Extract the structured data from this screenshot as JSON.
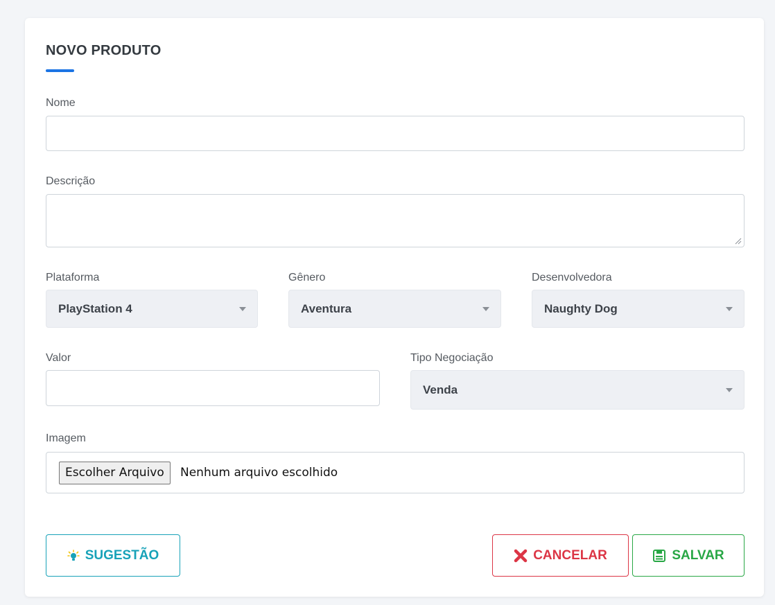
{
  "form": {
    "title": "NOVO PRODUTO",
    "fields": {
      "nome": {
        "label": "Nome",
        "value": ""
      },
      "descricao": {
        "label": "Descrição",
        "value": ""
      },
      "plataforma": {
        "label": "Plataforma",
        "value": "PlayStation 4"
      },
      "genero": {
        "label": "Gênero",
        "value": "Aventura"
      },
      "desenvolvedora": {
        "label": "Desenvolvedora",
        "value": "Naughty Dog"
      },
      "valor": {
        "label": "Valor",
        "value": ""
      },
      "tipo_negociacao": {
        "label": "Tipo Negociação",
        "value": "Venda"
      },
      "imagem": {
        "label": "Imagem",
        "button_label": "Escolher Arquivo",
        "status": "Nenhum arquivo escolhido"
      }
    },
    "actions": {
      "suggest_label": "SUGESTÃO",
      "cancel_label": "CANCELAR",
      "save_label": "SALVAR"
    }
  },
  "colors": {
    "accent": "#1b74e4",
    "info": "#17a2b8",
    "danger": "#dc3545",
    "success": "#28a745"
  },
  "icons": {
    "suggest": "lightbulb-icon",
    "cancel": "close-icon",
    "save": "save-icon",
    "select_caret": "caret-down-icon"
  }
}
